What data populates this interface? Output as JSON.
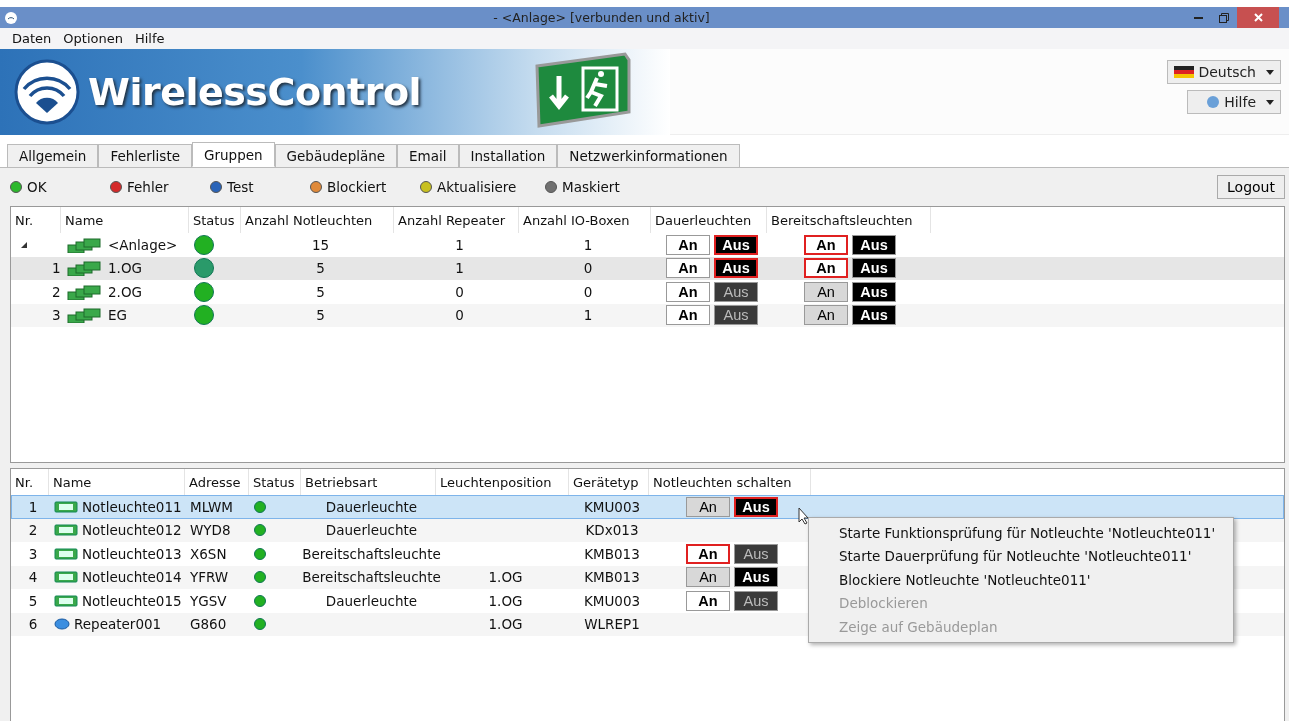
{
  "window": {
    "title": "- <Anlage> [verbunden und aktiv]"
  },
  "menu": [
    "Daten",
    "Optionen",
    "Hilfe"
  ],
  "banner": {
    "logo_text": "WirelessControl",
    "language": "Deutsch",
    "help": "Hilfe"
  },
  "tabs": [
    {
      "label": "Allgemein",
      "selected": false
    },
    {
      "label": "Fehlerliste",
      "selected": false
    },
    {
      "label": "Gruppen",
      "selected": true
    },
    {
      "label": "Gebäudepläne",
      "selected": false
    },
    {
      "label": "Email",
      "selected": false
    },
    {
      "label": "Installation",
      "selected": false
    },
    {
      "label": "Netzwerkinformationen",
      "selected": false
    }
  ],
  "legend": [
    {
      "label": "OK",
      "color": "#2db82d"
    },
    {
      "label": "Fehler",
      "color": "#d42a2a"
    },
    {
      "label": "Test",
      "color": "#2a64b8"
    },
    {
      "label": "Blockiert",
      "color": "#e08a3a"
    },
    {
      "label": "Aktualisiere",
      "color": "#c8c020"
    },
    {
      "label": "Maskiert",
      "color": "#707070"
    }
  ],
  "logout": "Logout",
  "groups": {
    "columns": [
      "Nr.",
      "Name",
      "Status",
      "Anzahl Notleuchten",
      "Anzahl Repeater",
      "Anzahl IO-Boxen",
      "Dauerleuchten",
      "Bereitschaftsleuchten"
    ],
    "rows": [
      {
        "name": "<Anlage>",
        "expanded": true,
        "selected": false,
        "color": "#22b022",
        "notleuchten": "15",
        "repeater": "1",
        "io_boxen": "1",
        "dauer": [
          {
            "label": "An",
            "bright": true,
            "outlined": false
          },
          {
            "label": "Aus",
            "bright": true,
            "outlined": true
          }
        ],
        "bereitschaft": [
          {
            "label": "An",
            "bright": true,
            "outlined": true
          },
          {
            "label": "Aus",
            "bright": true,
            "outlined": false
          }
        ],
        "children": [
          {
            "nr": "1",
            "name": "1.OG",
            "selected": true,
            "color": "#2a9a6a",
            "notleuchten": "5",
            "repeater": "1",
            "io_boxen": "0",
            "dauer": [
              {
                "label": "An",
                "bright": true,
                "outlined": false
              },
              {
                "label": "Aus",
                "bright": true,
                "outlined": true
              }
            ],
            "bereitschaft": [
              {
                "label": "An",
                "bright": true,
                "outlined": true
              },
              {
                "label": "Aus",
                "bright": true,
                "outlined": false
              }
            ]
          },
          {
            "nr": "2",
            "name": "2.OG",
            "selected": false,
            "color": "#22b022",
            "notleuchten": "5",
            "repeater": "0",
            "io_boxen": "0",
            "dauer": [
              {
                "label": "An",
                "bright": true,
                "outlined": false
              },
              {
                "label": "Aus",
                "bright": false,
                "outlined": false
              }
            ],
            "bereitschaft": [
              {
                "label": "An",
                "bright": false,
                "outlined": false
              },
              {
                "label": "Aus",
                "bright": true,
                "outlined": false
              }
            ]
          },
          {
            "nr": "3",
            "name": "EG",
            "selected": false,
            "color": "#22b022",
            "notleuchten": "5",
            "repeater": "0",
            "io_boxen": "1",
            "dauer": [
              {
                "label": "An",
                "bright": true,
                "outlined": false
              },
              {
                "label": "Aus",
                "bright": false,
                "outlined": false
              }
            ],
            "bereitschaft": [
              {
                "label": "An",
                "bright": false,
                "outlined": false
              },
              {
                "label": "Aus",
                "bright": true,
                "outlined": false
              }
            ]
          }
        ]
      }
    ]
  },
  "devices": {
    "columns": [
      "Nr.",
      "Name",
      "Adresse",
      "Status",
      "Betriebsart",
      "Leuchtenposition",
      "Gerätetyp",
      "Notleuchten schalten"
    ],
    "rows": [
      {
        "nr": "1",
        "kind": "lamp",
        "name": "Notleuchte011",
        "adresse": "MLWM",
        "color": "#22b022",
        "betriebsart": "Dauerleuchte",
        "position": "",
        "geraetetyp": "KMU003",
        "selected": true,
        "switches": [
          {
            "label": "An",
            "bright": false,
            "outlined": false
          },
          {
            "label": "Aus",
            "bright": true,
            "outlined": true
          }
        ]
      },
      {
        "nr": "2",
        "kind": "lamp",
        "name": "Notleuchte012",
        "adresse": "WYD8",
        "color": "#22b022",
        "betriebsart": "Dauerleuchte",
        "position": "",
        "geraetetyp": "KDx013",
        "selected": false,
        "switches": []
      },
      {
        "nr": "3",
        "kind": "lamp",
        "name": "Notleuchte013",
        "adresse": "X6SN",
        "color": "#22b022",
        "betriebsart": "Bereitschaftsleuchte",
        "position": "",
        "geraetetyp": "KMB013",
        "selected": false,
        "switches": [
          {
            "label": "An",
            "bright": true,
            "outlined": true
          },
          {
            "label": "Aus",
            "bright": false,
            "outlined": false
          }
        ]
      },
      {
        "nr": "4",
        "kind": "lamp",
        "name": "Notleuchte014",
        "adresse": "YFRW",
        "color": "#22b022",
        "betriebsart": "Bereitschaftsleuchte",
        "position": "1.OG",
        "geraetetyp": "KMB013",
        "selected": false,
        "switches": [
          {
            "label": "An",
            "bright": false,
            "outlined": false
          },
          {
            "label": "Aus",
            "bright": true,
            "outlined": false
          }
        ]
      },
      {
        "nr": "5",
        "kind": "lamp",
        "name": "Notleuchte015",
        "adresse": "YGSV",
        "color": "#22b022",
        "betriebsart": "Dauerleuchte",
        "position": "1.OG",
        "geraetetyp": "KMU003",
        "selected": false,
        "switches": [
          {
            "label": "An",
            "bright": true,
            "outlined": false
          },
          {
            "label": "Aus",
            "bright": false,
            "outlined": false
          }
        ]
      },
      {
        "nr": "6",
        "kind": "repeater",
        "name": "Repeater001",
        "adresse": "G860",
        "color": "#22b022",
        "betriebsart": "",
        "position": "1.OG",
        "geraetetyp": "WLREP1",
        "selected": false,
        "switches": []
      }
    ]
  },
  "context_menu": [
    {
      "label": "Starte Funktionsprüfung für Notleuchte 'Notleuchte011'",
      "disabled": false
    },
    {
      "label": "Starte Dauerprüfung für Notleuchte 'Notleuchte011'",
      "disabled": false
    },
    {
      "label": "Blockiere Notleuchte 'Notleuchte011'",
      "disabled": false
    },
    {
      "label": "Deblockieren",
      "disabled": true
    },
    {
      "label": "Zeige auf Gebäudeplan",
      "disabled": true
    }
  ]
}
